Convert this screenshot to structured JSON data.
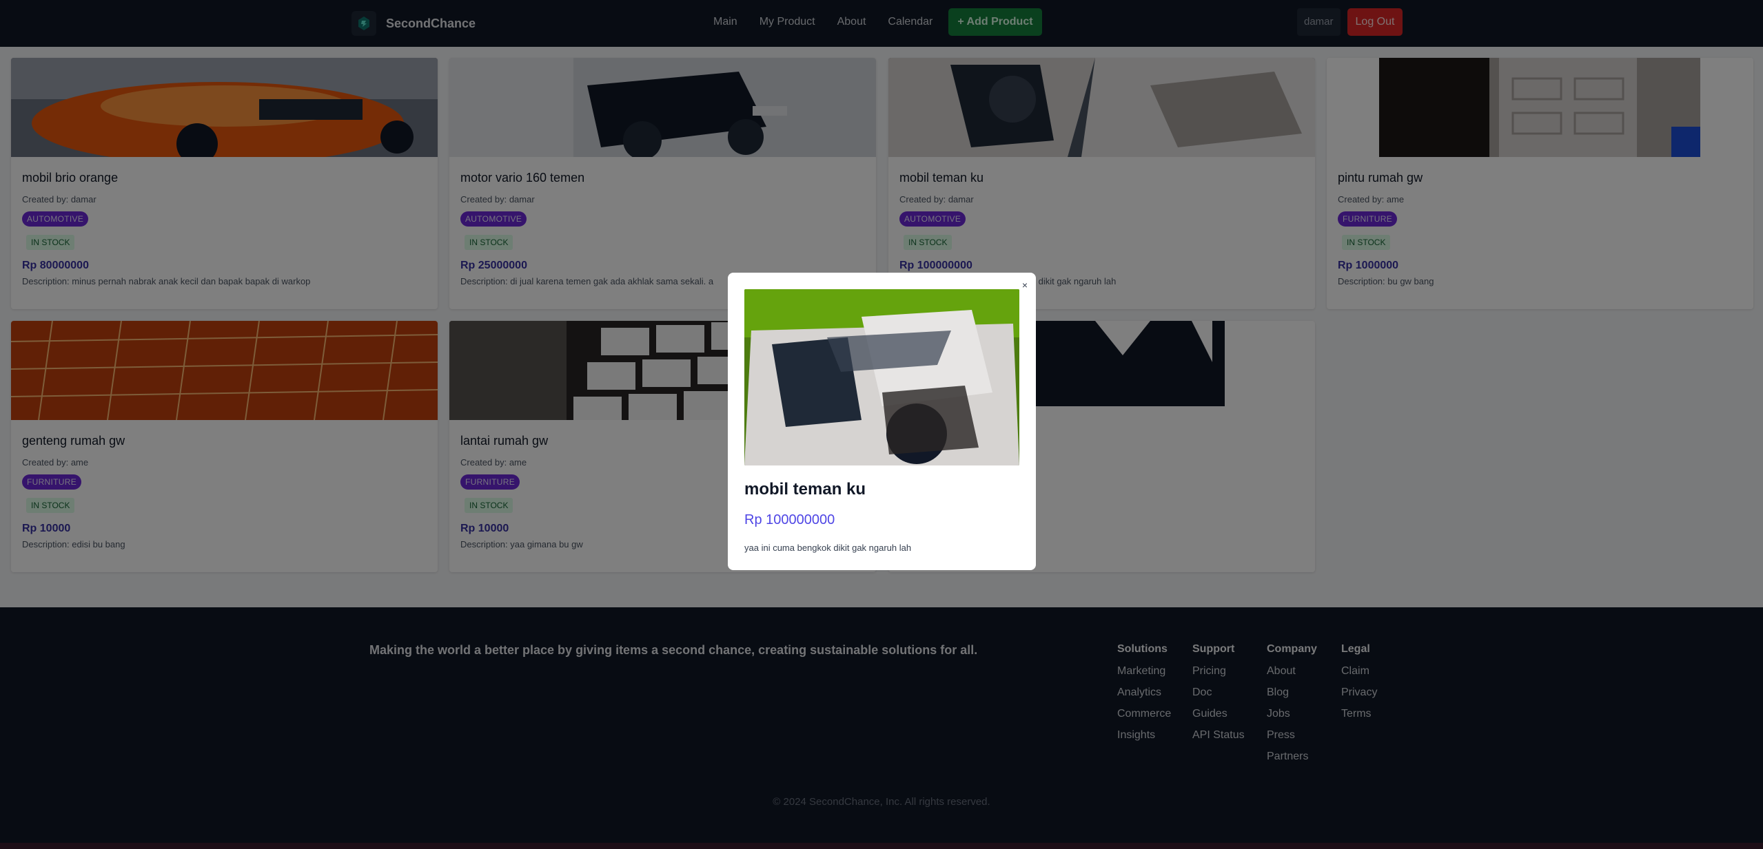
{
  "brand": {
    "name": "SecondChance",
    "logo_icon": "recycle-logo-icon"
  },
  "nav": {
    "links": [
      "Main",
      "My Product",
      "About",
      "Calendar"
    ],
    "add_product": "+ Add Product",
    "username": "damar",
    "logout": "Log Out"
  },
  "colors": {
    "navbar": "#111827",
    "add_button": "#15803d",
    "logout_button": "#dc2626",
    "category_badge": "#6d28d9",
    "price": "#3730a3",
    "modal_price": "#4f46e5"
  },
  "products": [
    {
      "title": "mobil brio orange",
      "created_by": "Created by: damar",
      "category": "AUTOMOTIVE",
      "stock": "IN STOCK",
      "price": "Rp 80000000",
      "description": "Description: minus pernah nabrak anak kecil dan bapak bapak di warkop"
    },
    {
      "title": "motor vario 160 temen",
      "created_by": "Created by: damar",
      "category": "AUTOMOTIVE",
      "stock": "IN STOCK",
      "price": "Rp 25000000",
      "description": "Description: di jual karena temen gak ada akhlak sama sekali. a"
    },
    {
      "title": "mobil teman ku",
      "created_by": "Created by: damar",
      "category": "AUTOMOTIVE",
      "stock": "IN STOCK",
      "price": "Rp 100000000",
      "description": "Description: yaa ini cuma bengkok dikit gak ngaruh lah"
    },
    {
      "title": "pintu rumah gw",
      "created_by": "Created by: ame",
      "category": "FURNITURE",
      "stock": "IN STOCK",
      "price": "Rp 1000000",
      "description": "Description: bu gw bang"
    },
    {
      "title": "genteng rumah gw",
      "created_by": "Created by: ame",
      "category": "FURNITURE",
      "stock": "IN STOCK",
      "price": "Rp 10000",
      "description": "Description: edisi bu bang"
    },
    {
      "title": "lantai rumah gw",
      "created_by": "Created by: ame",
      "category": "FURNITURE",
      "stock": "IN STOCK",
      "price": "Rp 10000",
      "description": "Description: yaa gimana bu gw"
    }
  ],
  "modal": {
    "title": "mobil teman ku",
    "price": "Rp 100000000",
    "description": "yaa ini cuma bengkok dikit gak ngaruh lah",
    "close": "×"
  },
  "footer": {
    "tagline": "Making the world a better place by giving items a second chance, creating sustainable solutions for all.",
    "columns": [
      {
        "heading": "Solutions",
        "links": [
          "Marketing",
          "Analytics",
          "Commerce",
          "Insights"
        ]
      },
      {
        "heading": "Support",
        "links": [
          "Pricing",
          "Doc",
          "Guides",
          "API Status"
        ]
      },
      {
        "heading": "Company",
        "links": [
          "About",
          "Blog",
          "Jobs",
          "Press",
          "Partners"
        ]
      },
      {
        "heading": "Legal",
        "links": [
          "Claim",
          "Privacy",
          "Terms"
        ]
      }
    ],
    "copyright": "© 2024 SecondChance, Inc. All rights reserved."
  }
}
